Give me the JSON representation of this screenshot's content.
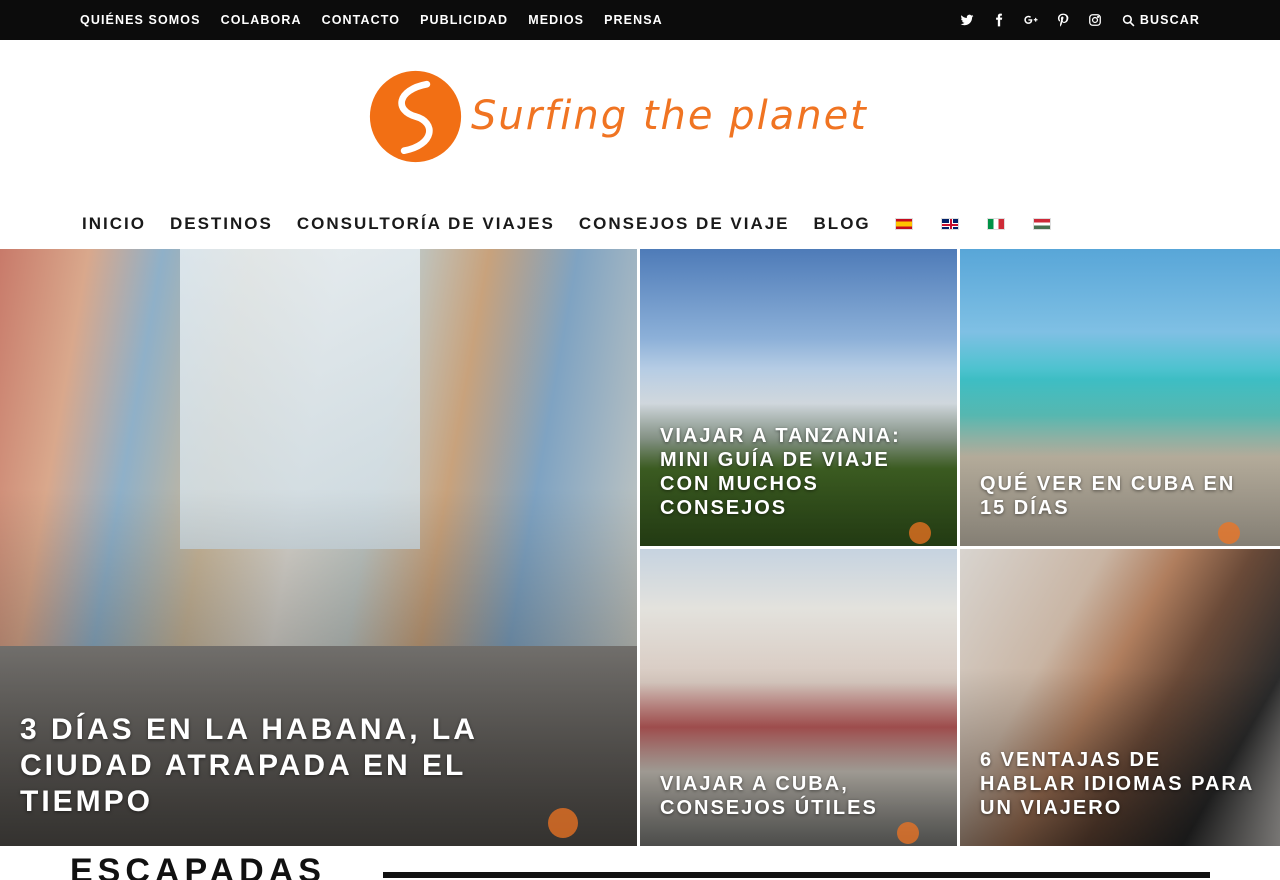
{
  "topbar": {
    "links": [
      "QUIÉNES SOMOS",
      "COLABORA",
      "CONTACTO",
      "PUBLICIDAD",
      "MEDIOS",
      "PRENSA"
    ],
    "social_icons": [
      "twitter-icon",
      "facebook-icon",
      "google-plus-icon",
      "pinterest-icon",
      "instagram-icon"
    ],
    "search_label": "BUSCAR"
  },
  "logo": {
    "text": "Surfing the planet",
    "brand_color": "#f07422"
  },
  "mainnav": {
    "items": [
      "INICIO",
      "DESTINOS",
      "CONSULTORÍA DE VIAJES",
      "CONSEJOS DE VIAJE",
      "BLOG"
    ],
    "flags": [
      "spanish-flag-icon",
      "english-flag-icon",
      "italian-flag-icon",
      "hungarian-flag-icon"
    ]
  },
  "featured": {
    "main_title": "3 DÍAS EN LA HABANA, LA CIUDAD ATRAPADA EN EL TIEMPO",
    "tanzania_title": "VIAJAR A TANZANIA: MINI GUÍA DE VIAJE CON MUCHOS CONSEJOS",
    "cuba15_title": "QUÉ VER EN CUBA EN 15 DÍAS",
    "consejos_title": "VIAJAR A CUBA, CONSEJOS ÚTILES",
    "idiomas_title": "6 VENTAJAS DE HABLAR IDIOMAS PARA UN VIAJERO"
  },
  "section": {
    "title": "ESCAPADAS"
  }
}
